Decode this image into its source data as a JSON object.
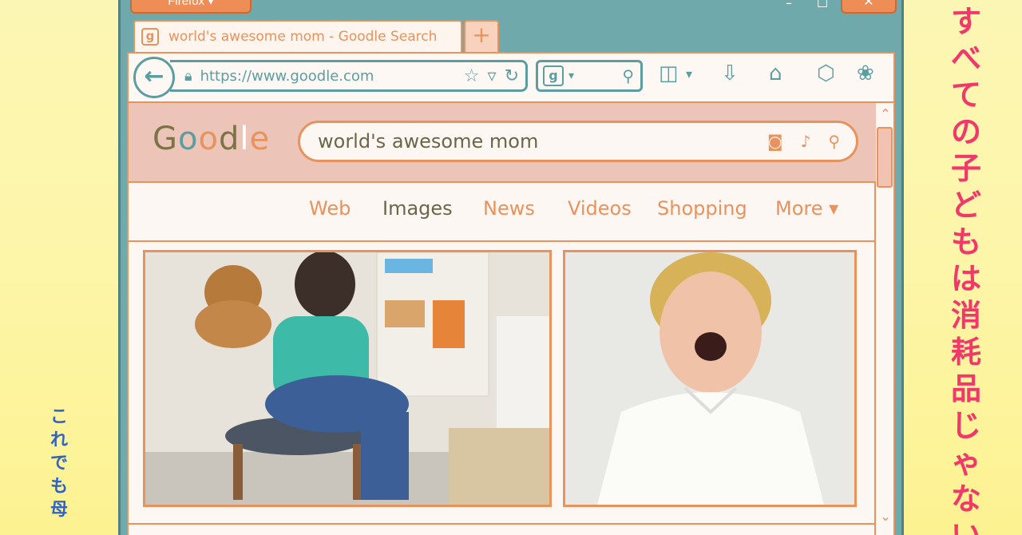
{
  "side": {
    "left_text": "これでも母",
    "right_text": "すべての子どもは消耗品じゃない"
  },
  "window": {
    "menu_button": "Firefox ▾",
    "minimize": "–",
    "maximize": "☐",
    "close": "✕"
  },
  "tab": {
    "favicon": "g",
    "title": "world's awesome mom - Goodle Search",
    "new_tab": "+"
  },
  "toolbar": {
    "back": "←",
    "url": "https://www.goodle.com",
    "search_engine_icon": "g"
  },
  "google": {
    "logo_letters": [
      "G",
      "o",
      "o",
      "d",
      "l",
      "e"
    ],
    "logo_colors": [
      "#7a7448",
      "#5c9ea0",
      "#e8935d",
      "#7a7448",
      "#ffffff",
      "#e8935d"
    ],
    "query": "world's awesome mom"
  },
  "nav": {
    "web": "Web",
    "images": "Images",
    "news": "News",
    "videos": "Videos",
    "shopping": "Shopping",
    "more": "More ▾"
  },
  "colors": {
    "accent": "#e8935d",
    "teal": "#5c9ea0",
    "header_pink": "#edc5b8",
    "right_text_red": "#f2386a",
    "left_text_blue": "#2f63c7"
  }
}
